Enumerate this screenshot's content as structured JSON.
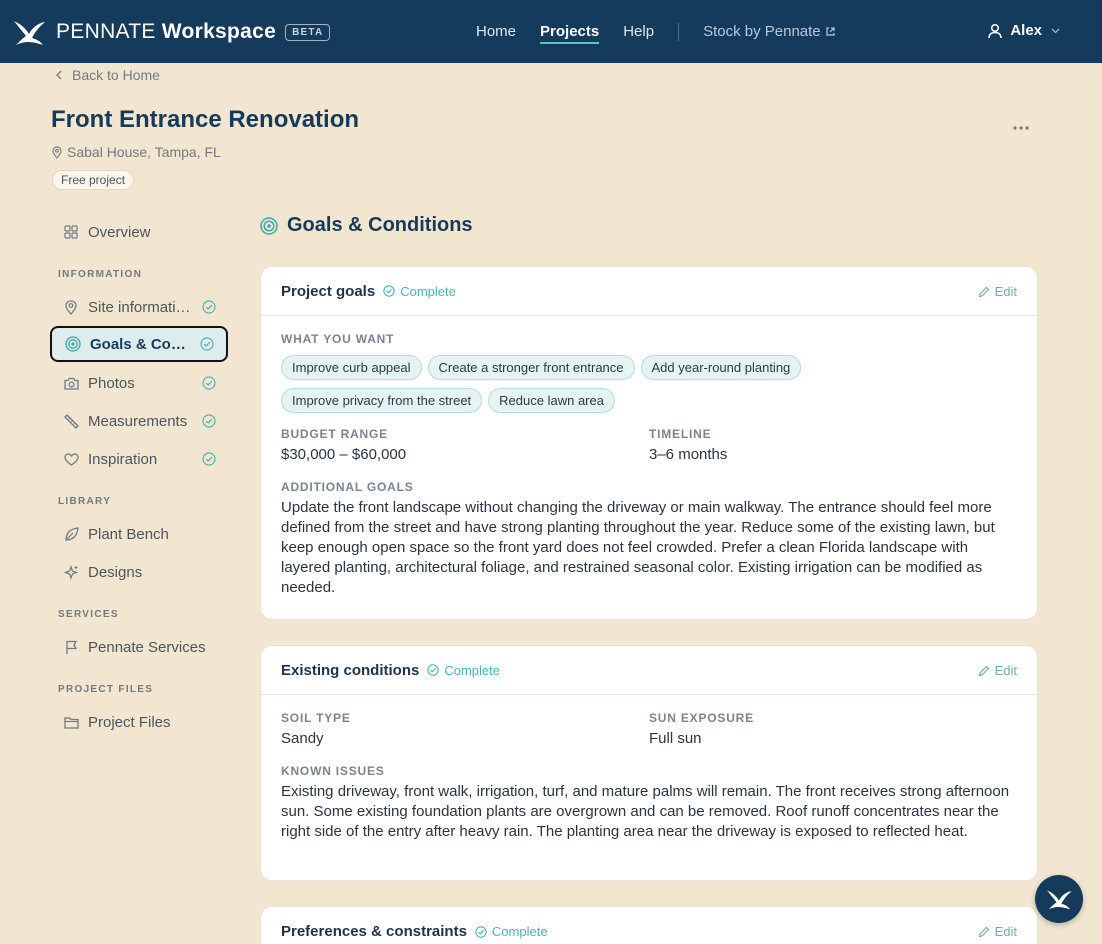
{
  "header": {
    "brand_light": "PENNATE",
    "brand_bold": "Workspace",
    "beta": "BETA",
    "nav": [
      {
        "label": "Home"
      },
      {
        "label": "Projects"
      },
      {
        "label": "Help"
      }
    ],
    "external_link": "Stock by Pennate",
    "user": "Alex",
    "colors": {
      "bar": "#143a5c",
      "accent": "#5cc1c4"
    }
  },
  "page": {
    "back": "Back to Home",
    "title": "Front Entrance Renovation",
    "location": "Sabal House, Tampa, FL",
    "badge": "Free project"
  },
  "sidebar": {
    "overview": "Overview",
    "sections": [
      {
        "title": "INFORMATION"
      },
      {
        "title": "LIBRARY"
      },
      {
        "title": "SERVICES"
      },
      {
        "title": "PROJECT FILES"
      }
    ],
    "info_items": [
      {
        "label": "Site information",
        "icon": "map-pin-icon",
        "complete": true
      },
      {
        "label": "Goals & Conditions",
        "icon": "target-icon",
        "complete": true,
        "active": true
      },
      {
        "label": "Photos",
        "icon": "camera-icon",
        "complete": true
      },
      {
        "label": "Measurements",
        "icon": "ruler-icon",
        "complete": true
      },
      {
        "label": "Inspiration",
        "icon": "heart-icon",
        "complete": true
      }
    ],
    "library_items": [
      {
        "label": "Plant Bench",
        "icon": "leaf-icon"
      },
      {
        "label": "Designs",
        "icon": "sparkle-icon"
      }
    ],
    "services_items": [
      {
        "label": "Pennate Services",
        "icon": "flag-icon"
      }
    ],
    "files_items": [
      {
        "label": "Project Files",
        "icon": "folder-icon"
      }
    ]
  },
  "main": {
    "section_title": "Goals & Conditions",
    "cards": {
      "goals": {
        "title": "Project goals",
        "status": "Complete",
        "edit": "Edit",
        "what_label": "WHAT YOU WANT",
        "chips": [
          "Improve curb appeal",
          "Create a stronger front entrance",
          "Add year-round planting",
          "Improve privacy from the street",
          "Reduce lawn area"
        ],
        "budget_label": "BUDGET RANGE",
        "budget": "$30,000 – $60,000",
        "timeline_label": "TIMELINE",
        "timeline": "3–6 months",
        "additional_label": "ADDITIONAL GOALS",
        "additional": "Update the front landscape without changing the driveway or main walkway. The entrance should feel more defined from the street and have strong planting throughout the year. Reduce some of the existing lawn, but keep enough open space so the front yard does not feel crowded. Prefer a clean Florida landscape with layered planting, architectural foliage, and restrained seasonal color. Existing irrigation can be modified as needed."
      },
      "conditions": {
        "title": "Existing conditions",
        "status": "Complete",
        "edit": "Edit",
        "soil_label": "SOIL TYPE",
        "soil": "Sandy",
        "sun_label": "SUN EXPOSURE",
        "sun": "Full sun",
        "issues_label": "KNOWN ISSUES",
        "issues": "Existing driveway, front walk, irrigation, turf, and mature palms will remain. The front receives strong afternoon sun. Some existing foundation plants are overgrown and can be removed. Roof runoff concentrates near the right side of the entry after heavy rain. The planting area near the driveway is exposed to reflected heat."
      },
      "preferences": {
        "title": "Preferences & constraints",
        "status": "Complete",
        "edit": "Edit"
      }
    }
  }
}
